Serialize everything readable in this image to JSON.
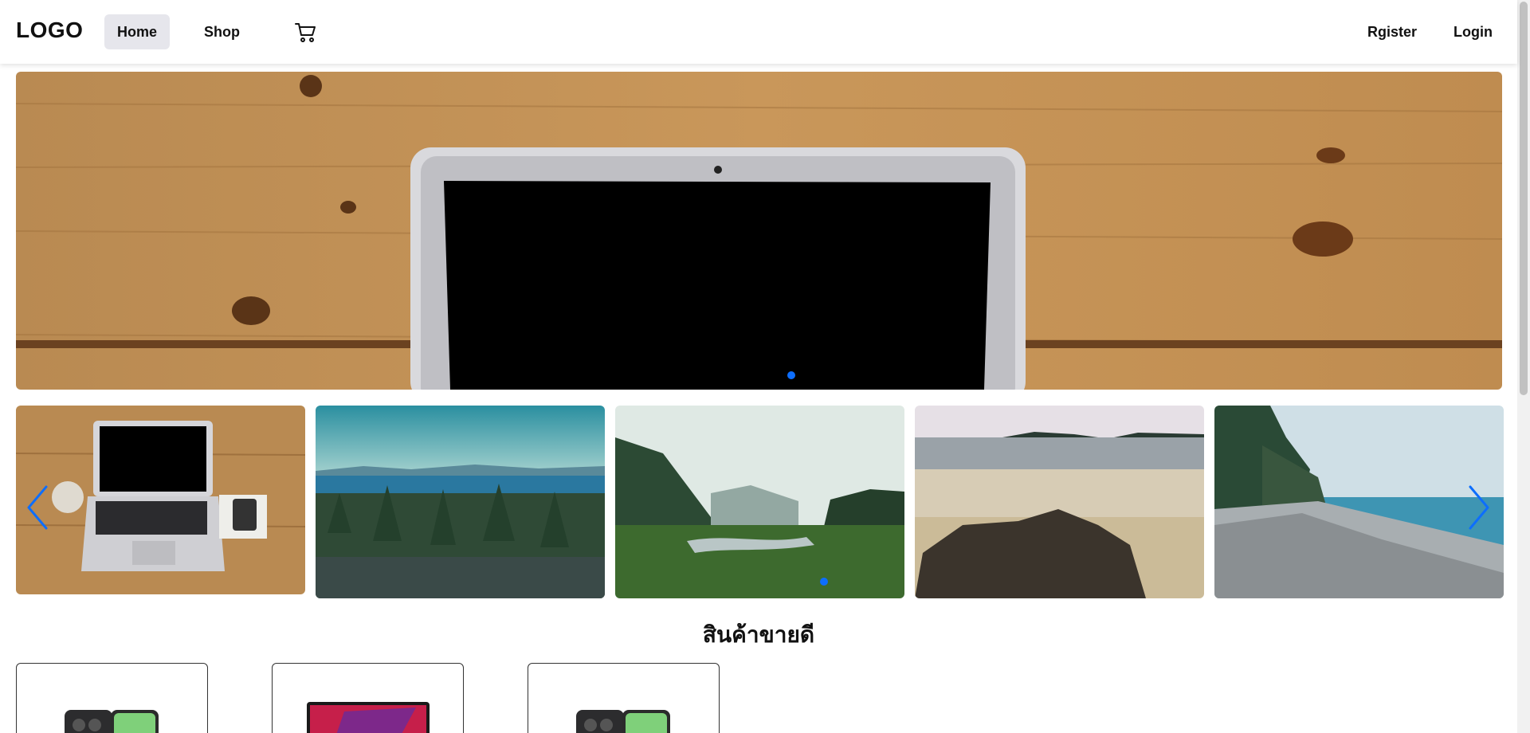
{
  "navbar": {
    "logo": "LOGO",
    "home_label": "Home",
    "shop_label": "Shop",
    "cart_icon": "cart-icon",
    "register_label": "Rgister",
    "login_label": "Login"
  },
  "hero": {
    "slide_image": "laptop-on-wooden-desk",
    "active_slide": 1,
    "indicator_color": "#0d6efd"
  },
  "thumbnail_carousel": {
    "prev_icon": "chevron-left-icon",
    "next_icon": "chevron-right-icon",
    "items": [
      {
        "image": "laptop-glass-phone-on-wood"
      },
      {
        "image": "forest-and-sea"
      },
      {
        "image": "river-valley"
      },
      {
        "image": "beach-rocks"
      },
      {
        "image": "pebble-shore"
      }
    ],
    "arrow_color": "#0d6efd"
  },
  "bestsellers": {
    "title": "สินค้าขายดี",
    "products": [
      {
        "image": "green-phone"
      },
      {
        "image": "rog-laptop"
      },
      {
        "image": "green-phone"
      }
    ]
  }
}
